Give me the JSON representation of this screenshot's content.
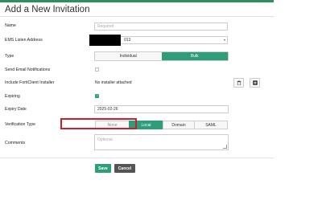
{
  "dialog": {
    "title": "Add a New Invitation"
  },
  "form": {
    "name": {
      "label": "Name",
      "placeholder": "Required"
    },
    "ems": {
      "label": "EMS Listen Address",
      "value_visible": "013"
    },
    "type": {
      "label": "Type",
      "options": [
        "Individual",
        "Bulk"
      ],
      "selected": "Bulk"
    },
    "send_email": {
      "label": "Send Email Notifications",
      "checked": false
    },
    "installer": {
      "label": "Include FortiClient Installer",
      "value": "No installer attached"
    },
    "expiring": {
      "label": "Expiring",
      "checked": true
    },
    "expiry_date": {
      "label": "Expiry Date",
      "value": "2025-02-26"
    },
    "verification": {
      "label": "Verification Type",
      "options": [
        "None",
        "Local",
        "Domain",
        "SAML"
      ],
      "selected": "Local"
    },
    "comments": {
      "label": "Comments",
      "placeholder": "Optional"
    }
  },
  "buttons": {
    "save": "Save",
    "cancel": "Cancel"
  },
  "icons": {
    "installer_delete": "trash-icon",
    "installer_add": "add-box-icon",
    "select_caret": "chevron-down-icon",
    "check": "checkmark-icon"
  },
  "colors": {
    "accent": "#2e9d7a",
    "highlight": "#c9202d",
    "cancel": "#555555"
  }
}
